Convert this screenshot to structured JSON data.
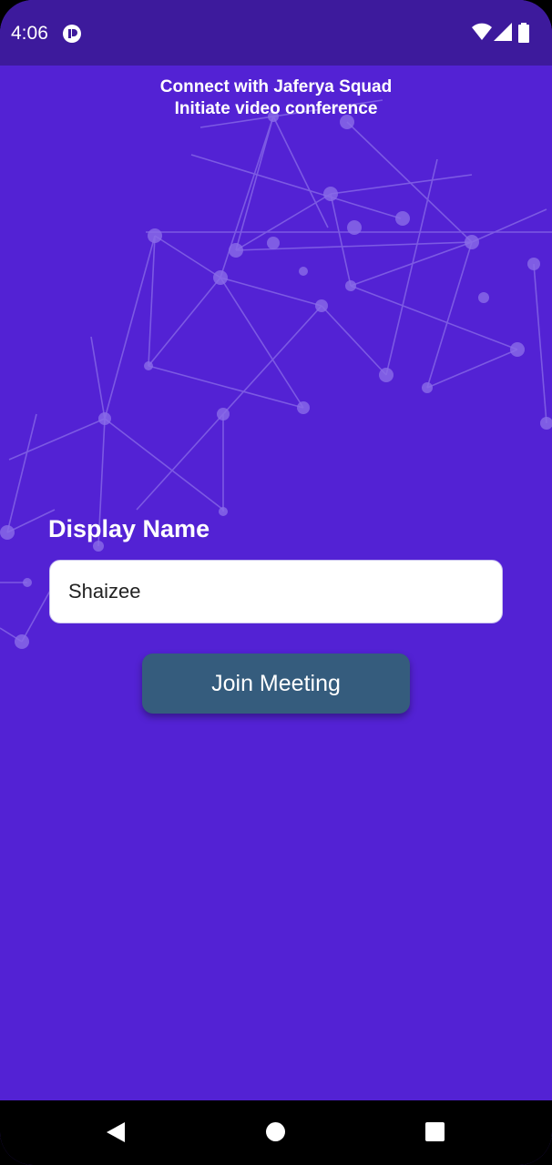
{
  "status_bar": {
    "time": "4:06",
    "icons": [
      "app-notification-icon",
      "wifi-icon",
      "signal-icon",
      "battery-icon"
    ]
  },
  "header": {
    "line1": "Connect with Jaferya Squad",
    "line2": "Initiate video conference"
  },
  "form": {
    "label": "Display Name",
    "name_value": "Shaizee",
    "join_label": "Join Meeting"
  },
  "nav_bar": {
    "icons": [
      "back-icon",
      "home-icon",
      "recents-icon"
    ]
  },
  "colors": {
    "background": "#5322d4",
    "status_bar": "#3d1a9c",
    "button": "#355c7d"
  }
}
